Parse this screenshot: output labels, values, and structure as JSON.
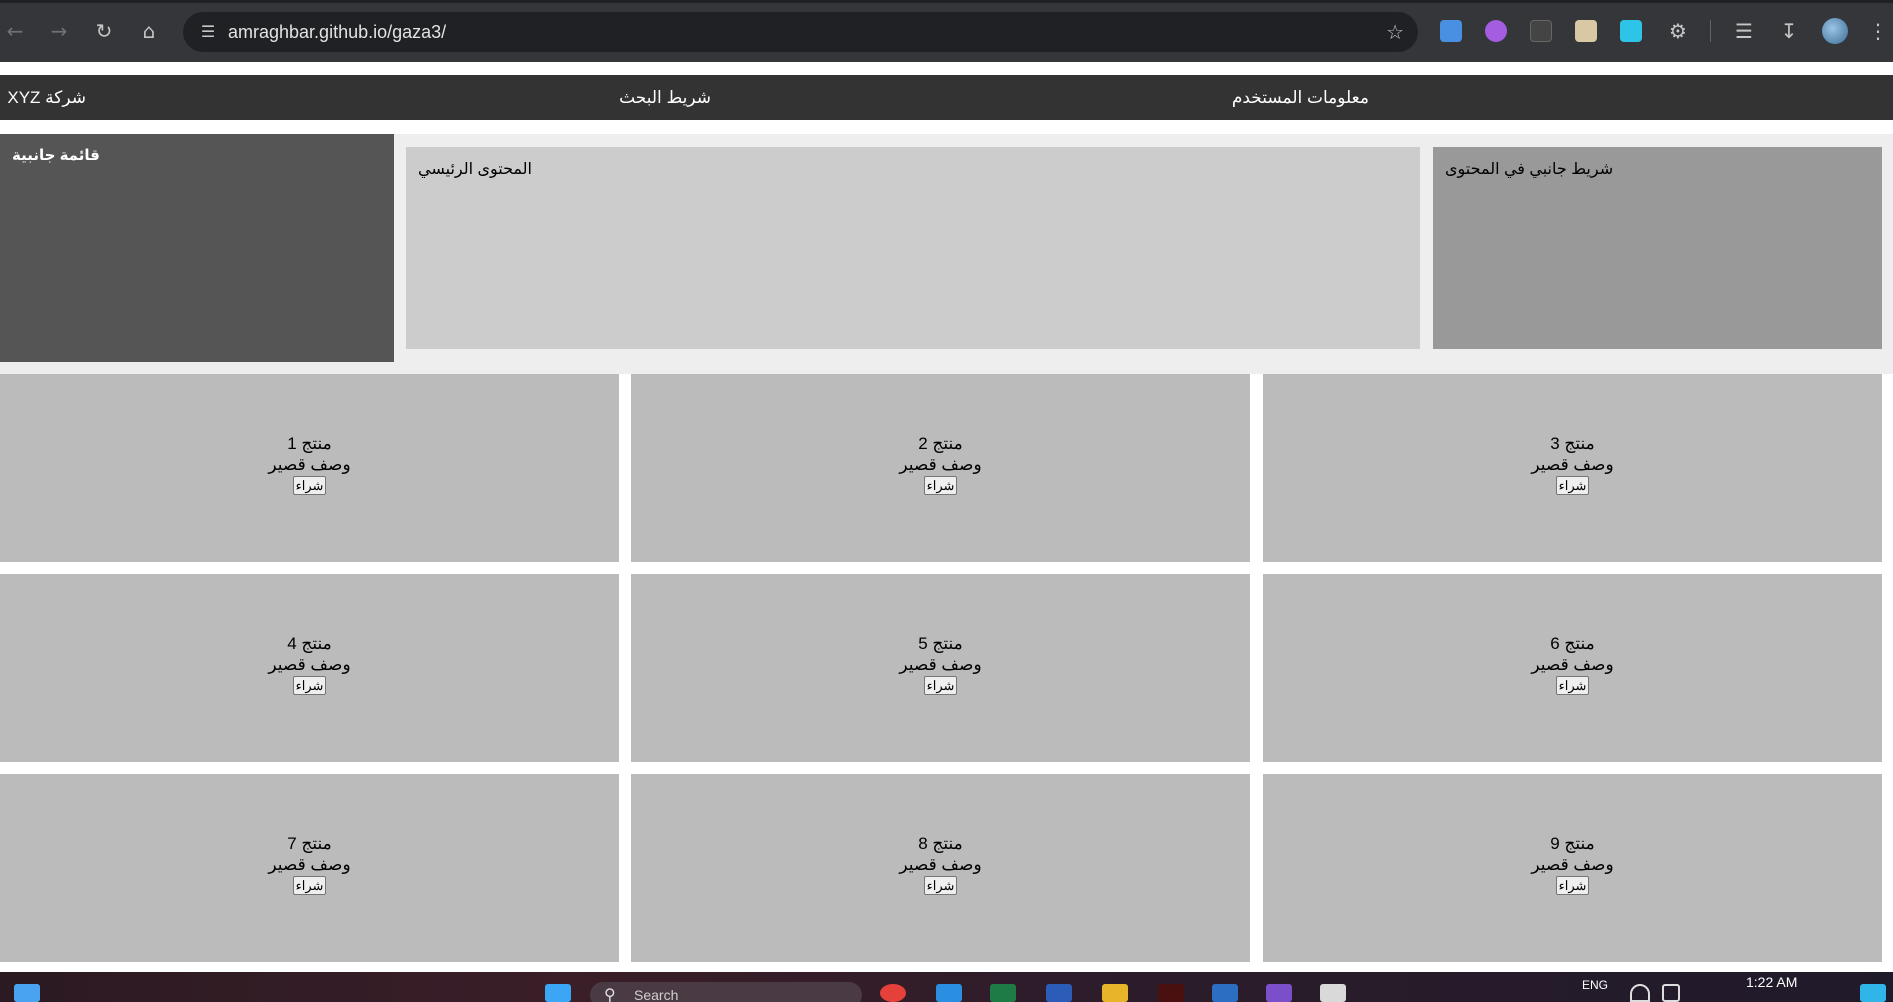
{
  "browser": {
    "url": "amraghbar.github.io/gaza3/",
    "icons": {
      "back": "arrow-left-icon",
      "forward": "arrow-right-icon",
      "reload": "reload-icon",
      "home": "home-icon",
      "site_info": "tune-icon",
      "bookmark": "star-icon",
      "reading_list": "list-icon",
      "downloads": "download-icon",
      "extensions": "puzzle-icon"
    }
  },
  "site": {
    "header": {
      "company": "شركة XYZ",
      "search": "شريط البحث",
      "user_info": "معلومات المستخدم"
    },
    "sidebar": {
      "title": "قائمة جانبية"
    },
    "main": {
      "title": "المحتوى الرئيسي"
    },
    "aside": {
      "title": "شريط جانبي في المحتوى"
    },
    "products": [
      {
        "name": "منتج 1",
        "desc": "وصف قصير",
        "button": "شراء"
      },
      {
        "name": "منتج 2",
        "desc": "وصف قصير",
        "button": "شراء"
      },
      {
        "name": "منتج 3",
        "desc": "وصف قصير",
        "button": "شراء"
      },
      {
        "name": "منتج 4",
        "desc": "وصف قصير",
        "button": "شراء"
      },
      {
        "name": "منتج 5",
        "desc": "وصف قصير",
        "button": "شراء"
      },
      {
        "name": "منتج 6",
        "desc": "وصف قصير",
        "button": "شراء"
      },
      {
        "name": "منتج 7",
        "desc": "وصف قصير",
        "button": "شراء"
      },
      {
        "name": "منتج 8",
        "desc": "وصف قصير",
        "button": "شراء"
      },
      {
        "name": "منتج 9",
        "desc": "وصف قصير",
        "button": "شراء"
      }
    ]
  },
  "taskbar": {
    "search_placeholder": "Search",
    "language": "ENG",
    "time": "1:22 AM"
  },
  "colors": {
    "header_bg": "#333333",
    "sidebar_bg": "#555555",
    "main_bg": "#cccccc",
    "aside_bg": "#999999",
    "product_bg": "#bbbbbb",
    "layout_bg": "#eeeeee"
  }
}
